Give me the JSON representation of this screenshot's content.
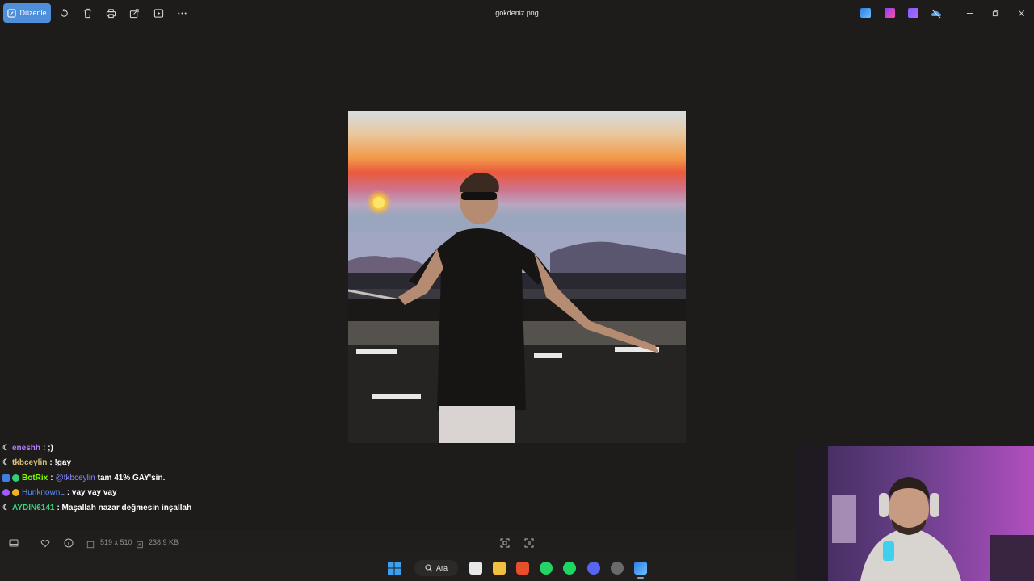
{
  "toolbar": {
    "edit_label": "Düzenle",
    "file_title": "gokdeniz.png",
    "icons": [
      "rotate-icon",
      "delete-icon",
      "print-icon",
      "share-icon",
      "slideshow-icon",
      "more-icon"
    ]
  },
  "chat": {
    "messages": [
      {
        "user": "eneshh",
        "text": ": ;)",
        "user_color": "#b57bff",
        "mention": ""
      },
      {
        "user": "tkbceylin",
        "text": ": !gay",
        "user_color": "#d8c27a",
        "mention": ""
      },
      {
        "user": "BotRix",
        "text": " tam 41% GAY'sin.",
        "user_color": "#7cfc00",
        "mention": "@tkbceylin"
      },
      {
        "user": "HunknownL",
        "text": ": vay vay vay",
        "user_color": "#5b8cff",
        "mention": ""
      },
      {
        "user": "AYDIN6141",
        "text": ": Maşallah nazar değmesin inşallah",
        "user_color": "#39d67a",
        "mention": ""
      }
    ],
    "separator": ":"
  },
  "statusbar": {
    "dimensions": "519 x 510",
    "file_size": "238.9 KB"
  },
  "taskbar": {
    "search_label": "Ara"
  },
  "colors": {
    "accent": "#4f8fd9",
    "background": "#1d1c1b"
  }
}
